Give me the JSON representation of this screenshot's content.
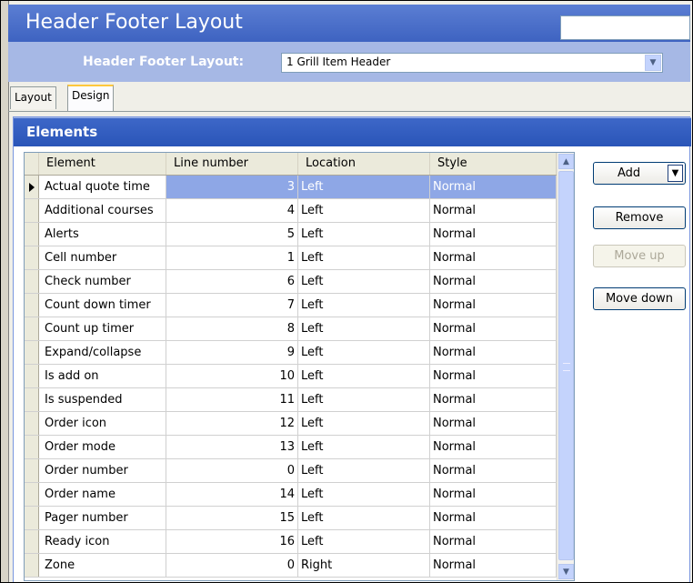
{
  "window": {
    "title": "Header Footer Layout"
  },
  "layout_selector": {
    "label": "Header Footer Layout:",
    "value": "1 Grill Item Header"
  },
  "tabs": [
    {
      "label": "Layout"
    },
    {
      "label": "Design"
    }
  ],
  "elements_panel": {
    "title": "Elements"
  },
  "grid": {
    "columns": [
      "Element",
      "Line number",
      "Location",
      "Style"
    ],
    "rows": [
      {
        "element": "Actual quote time",
        "line": "3",
        "location": "Left",
        "style": "Normal"
      },
      {
        "element": "Additional courses",
        "line": "4",
        "location": "Left",
        "style": "Normal"
      },
      {
        "element": "Alerts",
        "line": "5",
        "location": "Left",
        "style": "Normal"
      },
      {
        "element": "Cell number",
        "line": "1",
        "location": "Left",
        "style": "Normal"
      },
      {
        "element": "Check number",
        "line": "6",
        "location": "Left",
        "style": "Normal"
      },
      {
        "element": "Count down timer",
        "line": "7",
        "location": "Left",
        "style": "Normal"
      },
      {
        "element": "Count up timer",
        "line": "8",
        "location": "Left",
        "style": "Normal"
      },
      {
        "element": "Expand/collapse",
        "line": "9",
        "location": "Left",
        "style": "Normal"
      },
      {
        "element": "Is add on",
        "line": "10",
        "location": "Left",
        "style": "Normal"
      },
      {
        "element": "Is suspended",
        "line": "11",
        "location": "Left",
        "style": "Normal"
      },
      {
        "element": "Order icon",
        "line": "12",
        "location": "Left",
        "style": "Normal"
      },
      {
        "element": "Order mode",
        "line": "13",
        "location": "Left",
        "style": "Normal"
      },
      {
        "element": "Order number",
        "line": "0",
        "location": "Left",
        "style": "Normal"
      },
      {
        "element": "Order name",
        "line": "14",
        "location": "Left",
        "style": "Normal"
      },
      {
        "element": "Pager number",
        "line": "15",
        "location": "Left",
        "style": "Normal"
      },
      {
        "element": "Ready icon",
        "line": "16",
        "location": "Left",
        "style": "Normal"
      },
      {
        "element": "Zone",
        "line": "0",
        "location": "Right",
        "style": "Normal"
      }
    ],
    "selected_row": 0
  },
  "buttons": {
    "add": "Add",
    "remove": "Remove",
    "move_up": "Move up",
    "move_down": "Move down"
  },
  "colors": {
    "title_bar": "#3e63c1",
    "header_band": "#a6b8e5",
    "selection": "#8ea7e6",
    "tab_highlight": "#ffc83c"
  }
}
